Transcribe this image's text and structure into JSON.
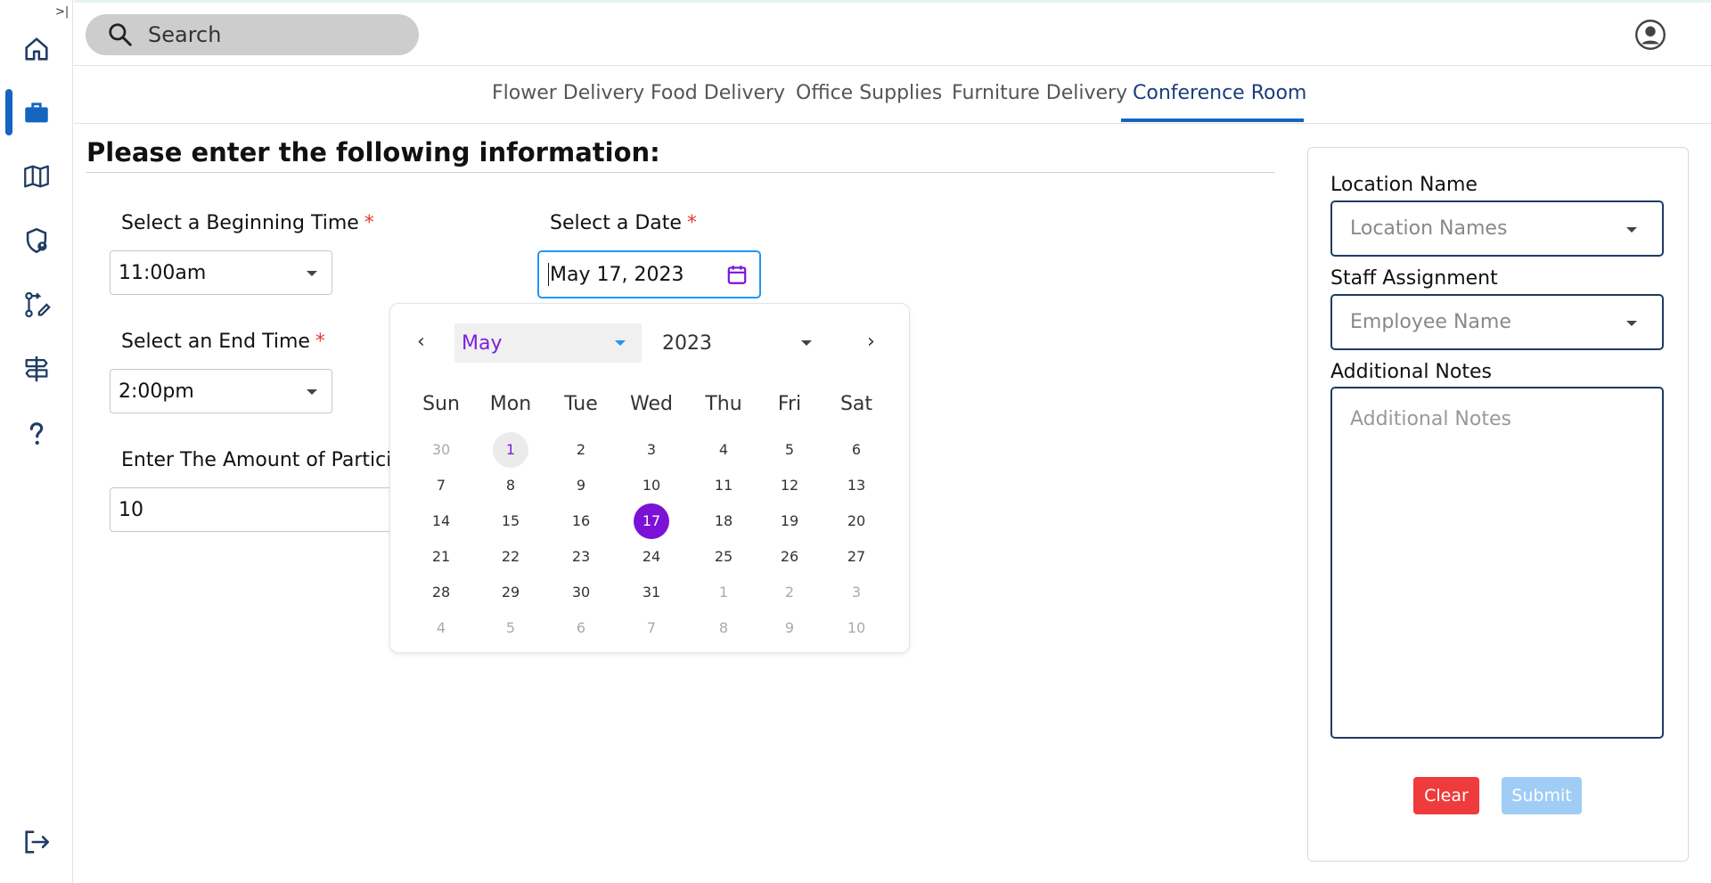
{
  "sidebar": {
    "collapse_glyph": ">|",
    "items": [
      {
        "name": "home-icon"
      },
      {
        "name": "briefcase-icon",
        "active": true
      },
      {
        "name": "map-icon"
      },
      {
        "name": "shield-user-icon"
      },
      {
        "name": "route-edit-icon"
      },
      {
        "name": "signpost-icon"
      },
      {
        "name": "help-icon"
      },
      {
        "name": "logout-icon"
      }
    ]
  },
  "header": {
    "search_placeholder": "Search"
  },
  "tabs": [
    {
      "label": "Flower Delivery"
    },
    {
      "label": "Food Delivery"
    },
    {
      "label": "Office Supplies"
    },
    {
      "label": "Furniture Delivery"
    },
    {
      "label": "Conference Room",
      "active": true
    }
  ],
  "form": {
    "title": "Please enter the following information:",
    "begin_time_label": "Select a Beginning Time",
    "begin_time_value": "11:00am",
    "end_time_label": "Select an End Time",
    "end_time_value": "2:00pm",
    "date_label": "Select a Date",
    "date_value": "May 17, 2023",
    "participants_label": "Enter The Amount of Participa",
    "participants_value": "10",
    "required_mark": "*"
  },
  "calendar": {
    "prev": "‹",
    "next": "›",
    "month": "May",
    "year": "2023",
    "weekdays": [
      "Sun",
      "Mon",
      "Tue",
      "Wed",
      "Thu",
      "Fri",
      "Sat"
    ],
    "weeks": [
      [
        "30",
        "1",
        "2",
        "3",
        "4",
        "5",
        "6"
      ],
      [
        "7",
        "8",
        "9",
        "10",
        "11",
        "12",
        "13"
      ],
      [
        "14",
        "15",
        "16",
        "17",
        "18",
        "19",
        "20"
      ],
      [
        "21",
        "22",
        "23",
        "24",
        "25",
        "26",
        "27"
      ],
      [
        "28",
        "29",
        "30",
        "31",
        "1",
        "2",
        "3"
      ],
      [
        "4",
        "5",
        "6",
        "7",
        "8",
        "9",
        "10"
      ]
    ],
    "selected_day": "17",
    "today_day": "1"
  },
  "panel": {
    "location_label": "Location Name",
    "location_placeholder": "Location Names",
    "staff_label": "Staff Assignment",
    "staff_placeholder": "Employee Name",
    "notes_label": "Additional Notes",
    "notes_placeholder": "Additional Notes",
    "clear_label": "Clear",
    "submit_label": "Submit"
  },
  "colors": {
    "accent": "#1565c0",
    "selected_day": "#7b12d6",
    "clear_button": "#ef3b3b",
    "submit_button": "#9fcdf5"
  }
}
